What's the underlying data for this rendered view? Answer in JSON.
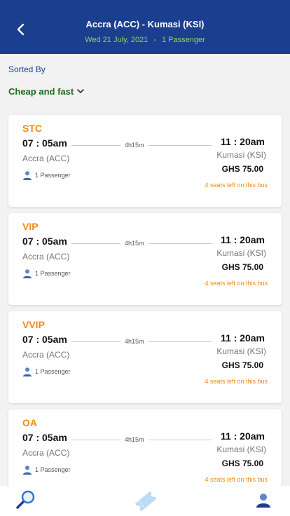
{
  "header": {
    "route": "Accra (ACC) - Kumasi (KSI)",
    "date": "Wed 21 July, 2021",
    "separator": "-",
    "passengers": "1 Passenger"
  },
  "sort": {
    "label": "Sorted By",
    "value": "Cheap and fast"
  },
  "trips": [
    {
      "bus": "STC",
      "departure": "07 : 05am",
      "duration": "4h15m",
      "arrival": "11 : 20am",
      "origin": "Accra (ACC)",
      "destination": "Kumasi (KSI)",
      "price": "GHS 75.00",
      "passengers": "1 Passenger",
      "seats": "4 seats left on this bus"
    },
    {
      "bus": "VIP",
      "departure": "07 : 05am",
      "duration": "4h15m",
      "arrival": "11 : 20am",
      "origin": "Accra (ACC)",
      "destination": "Kumasi (KSI)",
      "price": "GHS 75.00",
      "passengers": "1 Passenger",
      "seats": "4 seats left on this bus"
    },
    {
      "bus": "VVIP",
      "departure": "07 : 05am",
      "duration": "4h15m",
      "arrival": "11 : 20am",
      "origin": "Accra (ACC)",
      "destination": "Kumasi (KSI)",
      "price": "GHS 75.00",
      "passengers": "1 Passenger",
      "seats": "4 seats left on this bus"
    },
    {
      "bus": "OA",
      "departure": "07 : 05am",
      "duration": "4h15m",
      "arrival": "11 : 20am",
      "origin": "Accra (ACC)",
      "destination": "Kumasi (KSI)",
      "price": "GHS 75.00",
      "passengers": "1 Passenger",
      "seats": "4 seats left on this bus"
    }
  ],
  "nav": {
    "icons": [
      "search-icon",
      "ticket-icon",
      "profile-icon"
    ]
  },
  "colors": {
    "header_bg": "#1b3f8f",
    "accent_orange": "#f08a12",
    "sort_green": "#1e6b1f",
    "subline_green": "#8fd16a"
  }
}
